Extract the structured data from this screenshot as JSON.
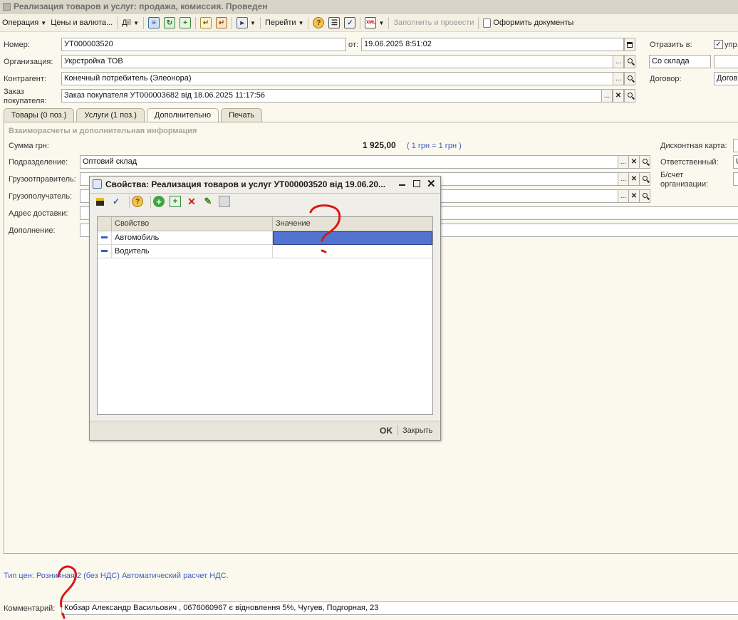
{
  "window": {
    "title": "Реализация товаров и услуг: продажа, комиссия. Проведен"
  },
  "toolbar": {
    "operation": "Операция",
    "prices": "Цены и валюта...",
    "actions": "Дії",
    "goto": "Перейти",
    "fill_post": "Заполнить и провести",
    "make_docs": "Оформить документы",
    "xml_label": "XML"
  },
  "header": {
    "number_label": "Номер:",
    "number_value": "УТ000003520",
    "date_label": "от:",
    "date_value": "19.06.2025  8:51:02",
    "reflect_label": "Отразить в:",
    "reflect_value": "упр.",
    "org_label": "Организация:",
    "org_value": "Укрстройка ТОВ",
    "warehouse_value": "Со склада",
    "contractor_label": "Контрагент:",
    "contractor_value": "Конечный потребитель (Элеонора)",
    "contract_label": "Договор:",
    "contract_value": "Догов",
    "order_label_1": "Заказ",
    "order_label_2": "покупателя:",
    "order_value": "Заказ покупателя УТ000003682 від 18.06.2025 11:17:56"
  },
  "tabs": [
    {
      "label": "Товары (0 поз.)",
      "active": false
    },
    {
      "label": "Услуги (1 поз.)",
      "active": false
    },
    {
      "label": "Дополнительно",
      "active": true
    },
    {
      "label": "Печать",
      "active": false
    }
  ],
  "extra": {
    "section_title": "Взаиморасчеты и дополнительная информация",
    "sum_label": "Сумма грн:",
    "sum_value": "1 925,00",
    "rate_link": "( 1 грн = 1 грн )",
    "discount_label": "Дисконтная карта:",
    "dept_label": "Подразделение:",
    "dept_value": "Оптовий склад",
    "responsible_label": "Ответственный:",
    "responsible_value": "U",
    "shipper_label": "Грузоотправитель:",
    "consignee_label": "Грузополучатель:",
    "account_label_1": "Б/счет",
    "account_label_2": "организации:",
    "address_label": "Адрес доставки:",
    "addition_label": "Дополнение:"
  },
  "footer": {
    "price_type": "Тип цен: Розничная 2 (без НДС) Автоматический расчет НДС.",
    "comment_label": "Комментарий:",
    "comment_value": "Кобзар Александр Васильович , 0676060967 є відновлення 5%, Чугуев, Подгорная, 23"
  },
  "dialog": {
    "title": "Свойства: Реализация товаров и услуг УТ000003520 від 19.06.20...",
    "col_property": "Свойство",
    "col_value": "Значение",
    "rows": [
      {
        "property": "Автомобиль",
        "value": ""
      },
      {
        "property": "Водитель",
        "value": ""
      }
    ],
    "ok": "OK",
    "close": "Закрыть"
  },
  "colors": {
    "accent_selection": "#5273cf",
    "annotation": "#d81818",
    "link": "#3d5fc0"
  },
  "icons": [
    "save-icon",
    "checkmark-icon",
    "help-icon",
    "add-icon",
    "copy-icon",
    "delete-icon",
    "edit-icon",
    "help-circle-icon",
    "magnifier-icon",
    "close-icon",
    "clear-icon",
    "minimize-icon",
    "maximize-icon",
    "checkbox-icon"
  ]
}
